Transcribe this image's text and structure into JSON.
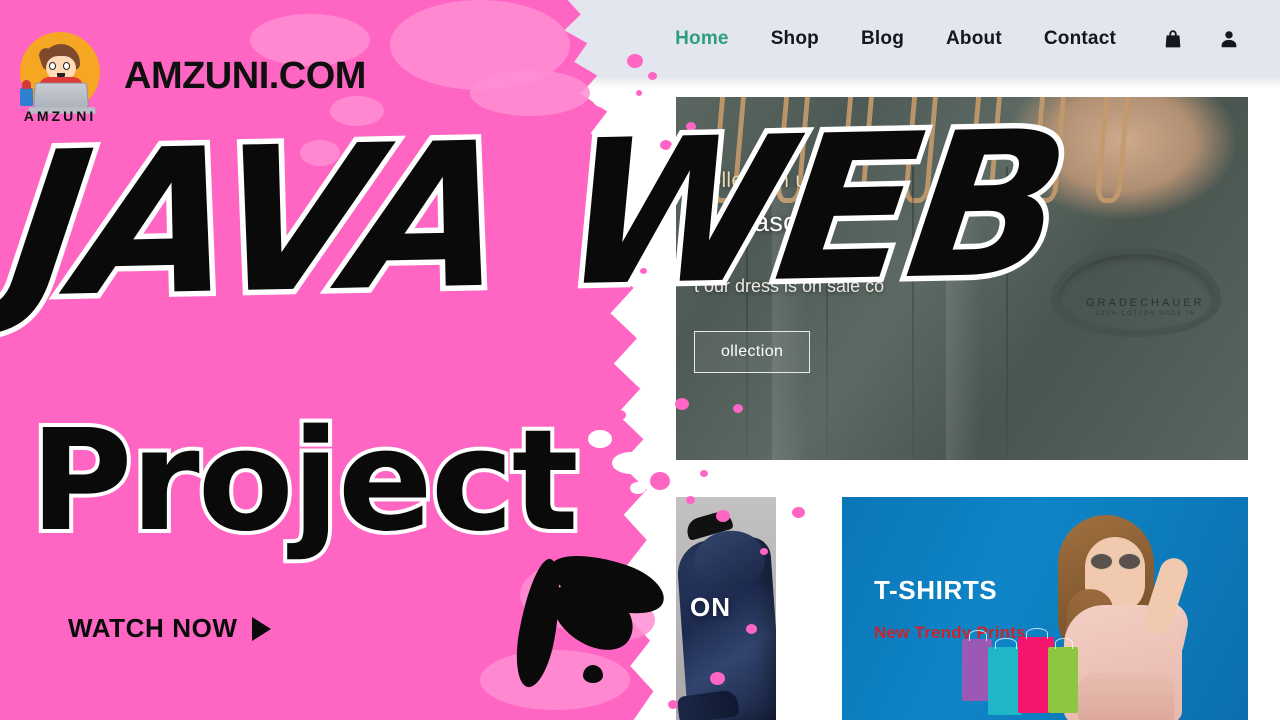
{
  "brand": {
    "name": "AMZUNI.COM",
    "logo_word": "AMZUNI",
    "logo_icon": "boy-with-laptop-logo-icon"
  },
  "title": {
    "line1": "JAVA WEB",
    "line2": "Project",
    "cta": "WATCH NOW",
    "cta_icon": "play-triangle-icon"
  },
  "colors": {
    "pink_background": "#FF66C4",
    "pink_light_blob": "#FF8ED4",
    "title_fill": "#0A0A0A",
    "title_outline": "#FFFFFF",
    "nav_background": "#E3E5EF",
    "nav_active": "#2E9E82",
    "card_blue": "#0A76B8",
    "card_red_text": "#C9252B"
  },
  "navbar": {
    "links": [
      {
        "label": "Home",
        "active": true
      },
      {
        "label": "Shop",
        "active": false
      },
      {
        "label": "Blog",
        "active": false
      },
      {
        "label": "About",
        "active": false
      },
      {
        "label": "Contact",
        "active": false
      }
    ],
    "icons": [
      {
        "name": "shopping-bag-icon"
      },
      {
        "name": "user-account-icon"
      }
    ]
  },
  "hero": {
    "eyebrow": "Collection up",
    "heading": "nt season",
    "subheading": "t our dress is on sale co",
    "cta": "ollection",
    "shirt_label": "GRADECHAUER",
    "shirt_label_sub": "100% COTTON MADE IN"
  },
  "cards": [
    {
      "name": "fashion-card",
      "label": "ON"
    },
    {
      "name": "tshirts-card",
      "title": "T-SHIRTS",
      "subtitle": "New Trendy Prints"
    }
  ]
}
